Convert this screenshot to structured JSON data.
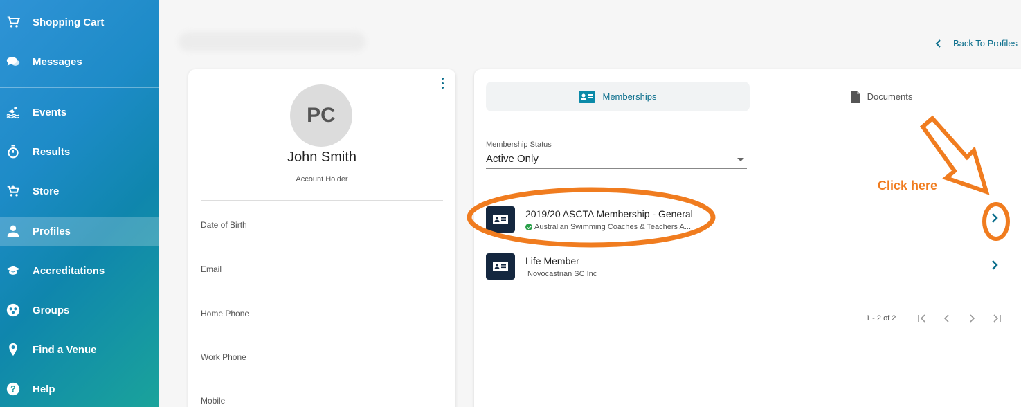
{
  "sidebar": {
    "items": [
      {
        "label": "Shopping Cart",
        "icon": "cart-icon"
      },
      {
        "label": "Messages",
        "icon": "chat-icon"
      },
      {
        "label": "Events",
        "icon": "swimmer-icon"
      },
      {
        "label": "Results",
        "icon": "stopwatch-icon"
      },
      {
        "label": "Store",
        "icon": "basket-icon"
      },
      {
        "label": "Profiles",
        "icon": "user-icon"
      },
      {
        "label": "Accreditations",
        "icon": "graduation-cap-icon"
      },
      {
        "label": "Groups",
        "icon": "group-icon"
      },
      {
        "label": "Find a Venue",
        "icon": "map-pin-icon"
      },
      {
        "label": "Help",
        "icon": "help-icon"
      }
    ],
    "active": "Profiles"
  },
  "header": {
    "back_label": "Back To Profiles"
  },
  "profile": {
    "initials": "PC",
    "name": "John Smith",
    "role": "Account Holder",
    "fields": [
      "Date of Birth",
      "Email",
      "Home Phone",
      "Work Phone",
      "Mobile"
    ]
  },
  "tabs": [
    {
      "label": "Memberships",
      "icon": "id-card-icon",
      "active": true
    },
    {
      "label": "Documents",
      "icon": "document-icon",
      "active": false
    }
  ],
  "filter": {
    "label": "Membership Status",
    "value": "Active Only"
  },
  "memberships": [
    {
      "title": "2019/20 ASCTA Membership - General",
      "org": "Australian Swimming Coaches & Teachers A...",
      "verified": true
    },
    {
      "title": "Life Member",
      "org": "Novocastrian SC Inc",
      "verified": false
    }
  ],
  "pagination": {
    "range": "1 - 2 of 2"
  },
  "annotation": {
    "text": "Click here",
    "color": "#f07c1f"
  },
  "colors": {
    "accent": "#0b6e8c",
    "badge": "#14273f",
    "verified": "#2aa04a"
  }
}
